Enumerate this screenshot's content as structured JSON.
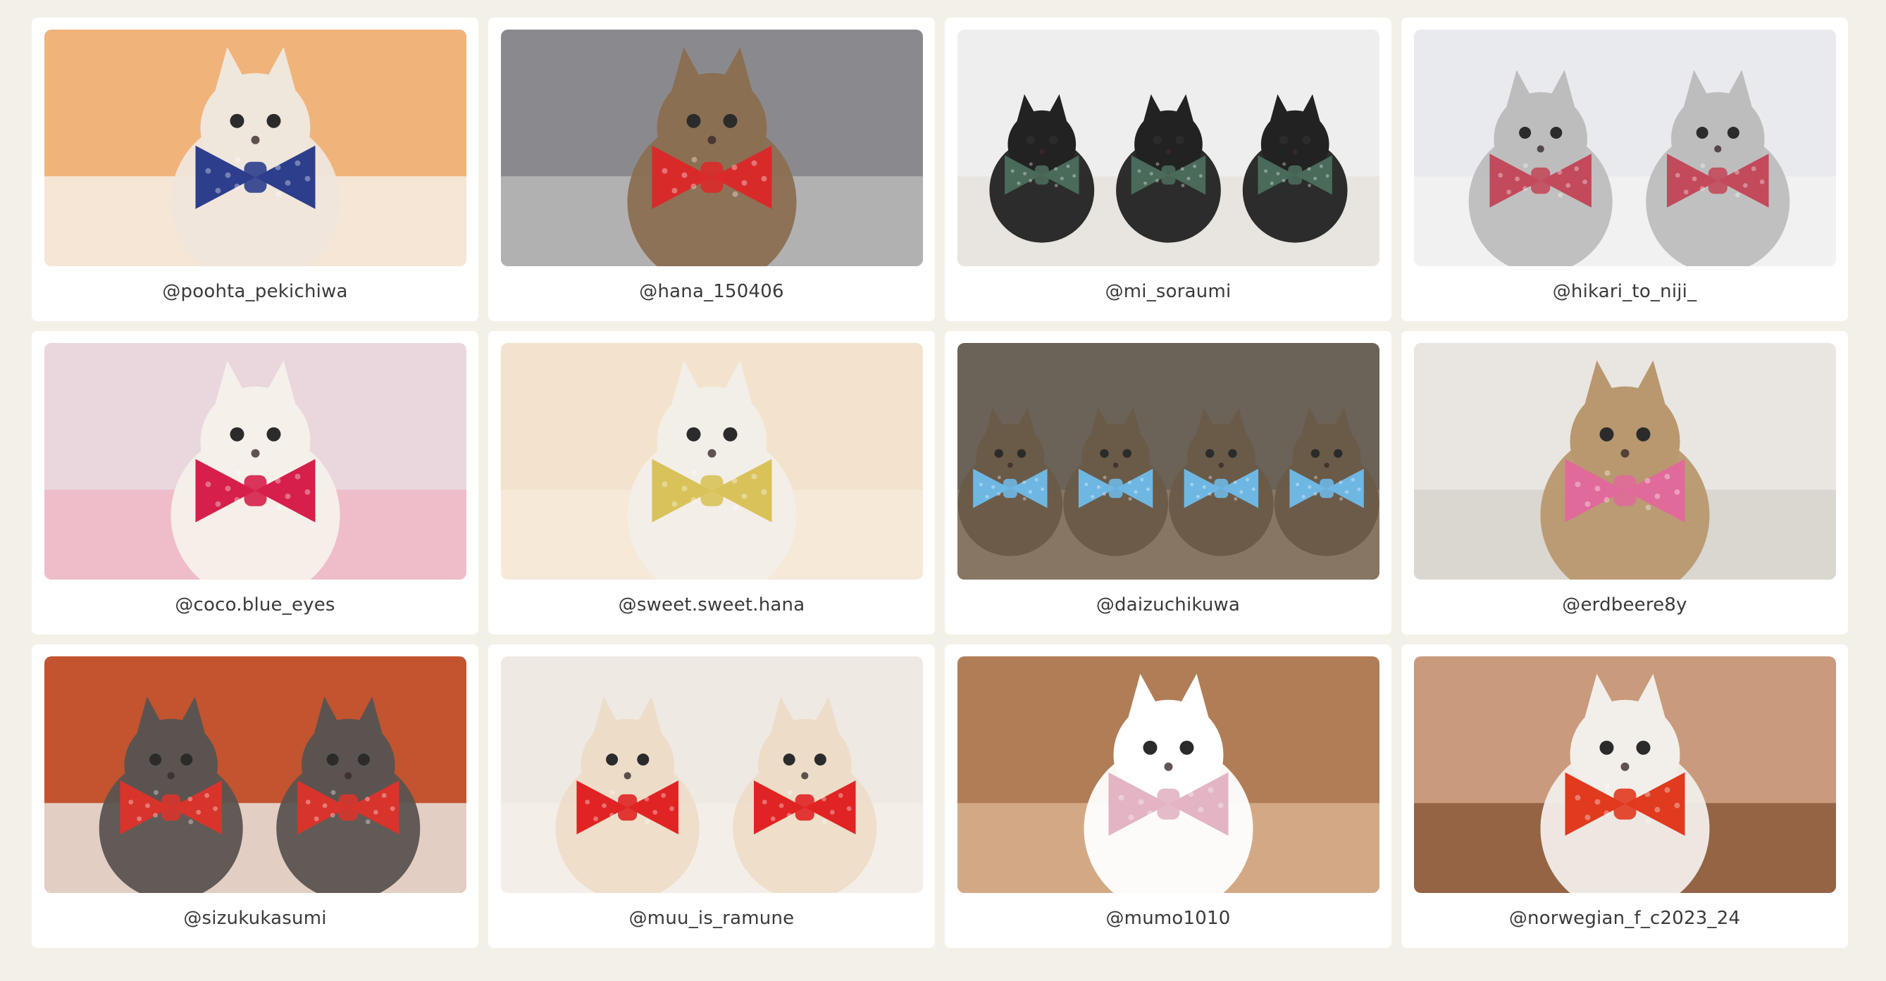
{
  "gallery": {
    "cards": [
      {
        "handle": "@poohta_pekichiwa",
        "bg": "#f0b37a",
        "floor": "#f6efe6",
        "pet": "#efe6dc",
        "accent": "#2c3e8c",
        "pet_kind": "dog"
      },
      {
        "handle": "@hana_150406",
        "bg": "#8a8a8e",
        "floor": "#b9b7b8",
        "pet": "#8b6f52",
        "accent": "#d92a2a",
        "pet_kind": "cat"
      },
      {
        "handle": "@mi_soraumi",
        "bg": "#eeeeee",
        "floor": "#e6e2dd",
        "pet": "#222222",
        "accent": "#4a6a5a",
        "pet_kind": "three-cats"
      },
      {
        "handle": "@hikari_to_niji_",
        "bg": "#e9eaee",
        "floor": "#f2f2f2",
        "pet": "#bdbdbd",
        "accent": "#c24a5a",
        "pet_kind": "two-cats"
      },
      {
        "handle": "@coco.blue_eyes",
        "bg": "#e9d7dd",
        "floor": "#f0b9c7",
        "pet": "#f5f0ea",
        "accent": "#d61f4a",
        "pet_kind": "cat"
      },
      {
        "handle": "@sweet.sweet.hana",
        "bg": "#f3e3cc",
        "floor": "#f6ead8",
        "pet": "#f2eee8",
        "accent": "#d9c25a",
        "pet_kind": "cat"
      },
      {
        "handle": "@daizuchikuwa",
        "bg": "#6b6258",
        "floor": "#8c7a66",
        "pet": "#6a5a48",
        "accent": "#6fb7e3",
        "pet_kind": "four-cats"
      },
      {
        "handle": "@erdbeere8y",
        "bg": "#e9e6e1",
        "floor": "#d7d2cc",
        "pet": "#b9986f",
        "accent": "#e06a9a",
        "pet_kind": "dog"
      },
      {
        "handle": "@sizukukasumi",
        "bg": "#c2542f",
        "floor": "#e9e4dd",
        "pet": "#5b5350",
        "accent": "#d8342c",
        "pet_kind": "two-cats"
      },
      {
        "handle": "@muu_is_ramune",
        "bg": "#efe9e4",
        "floor": "#f4efe9",
        "pet": "#eddcc8",
        "accent": "#e02323",
        "pet_kind": "two-cats"
      },
      {
        "handle": "@mumo1010",
        "bg": "#b07d56",
        "floor": "#d9b08d",
        "pet": "#ffffff",
        "accent": "#e3b4c3",
        "pet_kind": "dog"
      },
      {
        "handle": "@norwegian_f_c2023_24",
        "bg": "#c99a7c",
        "floor": "#8c5a3c",
        "pet": "#f2eeea",
        "accent": "#e03a1f",
        "pet_kind": "cat"
      }
    ]
  }
}
